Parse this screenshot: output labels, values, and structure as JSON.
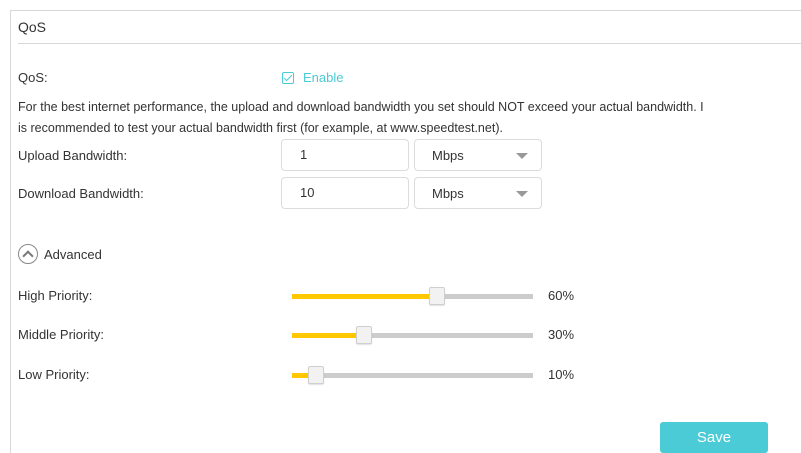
{
  "section": {
    "title": "QoS"
  },
  "qos": {
    "label": "QoS:",
    "enable_label": "Enable",
    "enabled": true
  },
  "note": {
    "line1": "For the best internet performance, the upload and download bandwidth you set should NOT exceed your actual bandwidth. I",
    "line2": "is recommended to test your actual bandwidth first (for example, at www.speedtest.net)."
  },
  "upload": {
    "label": "Upload Bandwidth:",
    "value": "1",
    "unit": "Mbps"
  },
  "download": {
    "label": "Download Bandwidth:",
    "value": "10",
    "unit": "Mbps"
  },
  "advanced": {
    "label": "Advanced",
    "icon": "chevron-up-circle-icon"
  },
  "priorities": [
    {
      "label": "High Priority:",
      "value": 60,
      "display": "60%"
    },
    {
      "label": "Middle Priority:",
      "value": 30,
      "display": "30%"
    },
    {
      "label": "Low Priority:",
      "value": 10,
      "display": "10%"
    }
  ],
  "save_label": "Save",
  "colors": {
    "accent": "#4acbd6",
    "slider_fill": "#ffc800",
    "slider_track": "#cccccc"
  }
}
